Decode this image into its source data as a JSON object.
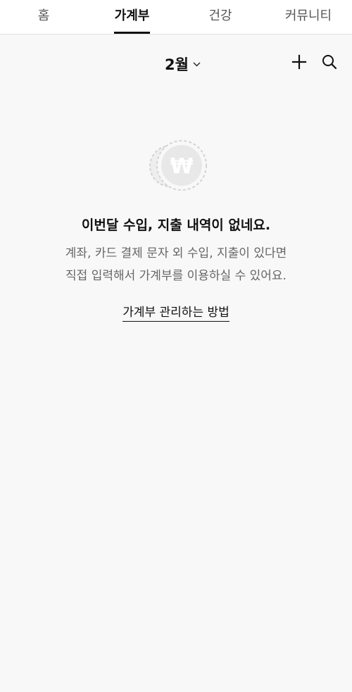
{
  "tabs": [
    {
      "label": "홈"
    },
    {
      "label": "가계부"
    },
    {
      "label": "건강"
    },
    {
      "label": "커뮤니티"
    }
  ],
  "header": {
    "month": "2월",
    "month_icon": "chevron-down-icon",
    "add_icon": "plus-icon",
    "search_icon": "search-icon"
  },
  "empty_state": {
    "icon": "won-coin-icon",
    "icon_symbol": "₩",
    "title": "이번달 수입, 지출 내역이 없네요.",
    "desc_line1": "계좌, 카드 결제 문자 외 수입, 지출이 있다면",
    "desc_line2": "직접 입력해서 가계부를 이용하실 수 있어요.",
    "link": "가계부 관리하는 방법"
  },
  "colors": {
    "background": "#f8f8f8",
    "active_tab": "#111111",
    "inactive_tab": "#555555",
    "muted_text": "#666666",
    "coin": "#d6d6d6"
  }
}
